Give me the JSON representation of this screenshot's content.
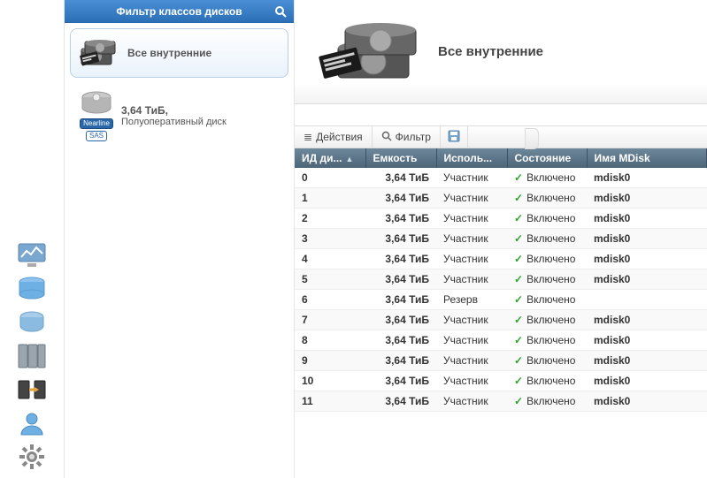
{
  "sidebar": {
    "header": "Фильтр классов дисков",
    "items": [
      {
        "label": "Все внутренние",
        "selected": true
      },
      {
        "line1": "3,64 ТиБ,",
        "line2": "Полуоперативный диск",
        "badge_top": "Nearline",
        "badge_bottom": "SAS",
        "selected": false
      }
    ]
  },
  "hero": {
    "title": "Все внутренние"
  },
  "toolbar": {
    "actions_label": "Действия",
    "filter_label": "Фильтр"
  },
  "table": {
    "columns": {
      "id": "ИД ди...",
      "capacity": "Емкость",
      "usage": "Исполь...",
      "state": "Состояние",
      "mdisk": "Имя MDisk"
    },
    "rows": [
      {
        "id": "0",
        "capacity": "3,64 ТиБ",
        "usage": "Участник",
        "state": "Включено",
        "mdisk": "mdisk0"
      },
      {
        "id": "1",
        "capacity": "3,64 ТиБ",
        "usage": "Участник",
        "state": "Включено",
        "mdisk": "mdisk0"
      },
      {
        "id": "2",
        "capacity": "3,64 ТиБ",
        "usage": "Участник",
        "state": "Включено",
        "mdisk": "mdisk0"
      },
      {
        "id": "3",
        "capacity": "3,64 ТиБ",
        "usage": "Участник",
        "state": "Включено",
        "mdisk": "mdisk0"
      },
      {
        "id": "4",
        "capacity": "3,64 ТиБ",
        "usage": "Участник",
        "state": "Включено",
        "mdisk": "mdisk0"
      },
      {
        "id": "5",
        "capacity": "3,64 ТиБ",
        "usage": "Участник",
        "state": "Включено",
        "mdisk": "mdisk0"
      },
      {
        "id": "6",
        "capacity": "3,64 ТиБ",
        "usage": "Резерв",
        "state": "Включено",
        "mdisk": ""
      },
      {
        "id": "7",
        "capacity": "3,64 ТиБ",
        "usage": "Участник",
        "state": "Включено",
        "mdisk": "mdisk0"
      },
      {
        "id": "8",
        "capacity": "3,64 ТиБ",
        "usage": "Участник",
        "state": "Включено",
        "mdisk": "mdisk0"
      },
      {
        "id": "9",
        "capacity": "3,64 ТиБ",
        "usage": "Участник",
        "state": "Включено",
        "mdisk": "mdisk0"
      },
      {
        "id": "10",
        "capacity": "3,64 ТиБ",
        "usage": "Участник",
        "state": "Включено",
        "mdisk": "mdisk0"
      },
      {
        "id": "11",
        "capacity": "3,64 ТиБ",
        "usage": "Участник",
        "state": "Включено",
        "mdisk": "mdisk0"
      }
    ]
  }
}
